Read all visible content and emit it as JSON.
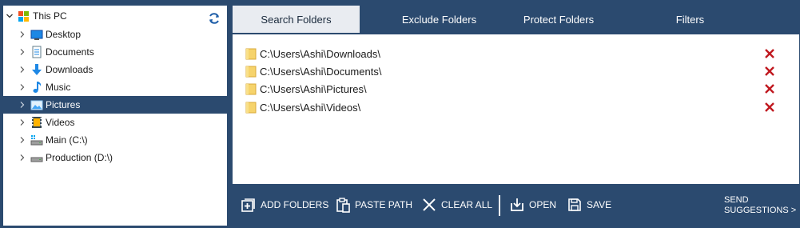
{
  "tree": {
    "root_label": "This PC",
    "items": [
      {
        "label": "Desktop",
        "icon": "desktop-icon"
      },
      {
        "label": "Documents",
        "icon": "documents-icon"
      },
      {
        "label": "Downloads",
        "icon": "downloads-icon"
      },
      {
        "label": "Music",
        "icon": "music-icon"
      },
      {
        "label": "Pictures",
        "icon": "pictures-icon",
        "selected": true
      },
      {
        "label": "Videos",
        "icon": "videos-icon"
      },
      {
        "label": "Main (C:\\)",
        "icon": "drive-c-icon"
      },
      {
        "label": "Production (D:\\)",
        "icon": "drive-d-icon"
      }
    ]
  },
  "tabs": [
    "Search Folders",
    "Exclude Folders",
    "Protect Folders",
    "Filters"
  ],
  "folders": [
    "C:\\Users\\Ashi\\Downloads\\",
    "C:\\Users\\Ashi\\Documents\\",
    "C:\\Users\\Ashi\\Pictures\\",
    "C:\\Users\\Ashi\\Videos\\"
  ],
  "toolbar": {
    "add_folders": "ADD FOLDERS",
    "paste_path": "PASTE PATH",
    "clear_all": "CLEAR ALL",
    "open": "OPEN",
    "save": "SAVE",
    "suggest_line1": "SEND",
    "suggest_line2": "SUGGESTIONS >"
  },
  "colors": {
    "panel_background": "#2b4a6f",
    "selection": "#2b4a6f",
    "active_tab": "#e9ecf1",
    "remove_icon": "#c0181f",
    "folder_icon": "#f6d36b"
  }
}
